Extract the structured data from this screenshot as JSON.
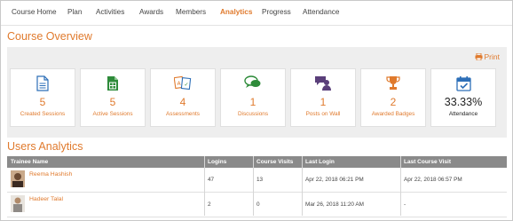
{
  "tabs": [
    {
      "label": "Course Home",
      "active": false
    },
    {
      "label": "Plan",
      "active": false
    },
    {
      "label": "Activities",
      "active": false
    },
    {
      "label": "Awards",
      "active": false
    },
    {
      "label": "Members",
      "active": false
    },
    {
      "label": "Analytics",
      "active": true
    },
    {
      "label": "Progress",
      "active": false
    },
    {
      "label": "Attendance",
      "active": false
    }
  ],
  "overview": {
    "title": "Course Overview",
    "print_label": "Print",
    "cards": [
      {
        "icon": "document-icon",
        "value": "5",
        "label": "Created Sessions"
      },
      {
        "icon": "spreadsheet-icon",
        "value": "5",
        "label": "Active Sessions"
      },
      {
        "icon": "assessment-icon",
        "value": "4",
        "label": "Assessments"
      },
      {
        "icon": "chat-bubbles-icon",
        "value": "1",
        "label": "Discussions"
      },
      {
        "icon": "users-chat-icon",
        "value": "1",
        "label": "Posts on Wall"
      },
      {
        "icon": "trophy-icon",
        "value": "2",
        "label": "Awarded Badges"
      },
      {
        "icon": "calendar-check-icon",
        "value": "33.33%",
        "label": "Attendance"
      }
    ]
  },
  "users_analytics": {
    "title": "Users Analytics",
    "columns": [
      "Trainee Name",
      "Logins",
      "Course Visits",
      "Last Login",
      "Last Course Visit"
    ],
    "rows": [
      {
        "name": "Reema Hashish",
        "logins": "47",
        "visits": "13",
        "last_login": "Apr 22, 2018 06:21 PM",
        "last_visit": "Apr 22, 2018 06:57 PM"
      },
      {
        "name": "Hadeer Talal",
        "logins": "2",
        "visits": "0",
        "last_login": "Mar 26, 2018 11:20 AM",
        "last_visit": "-"
      }
    ]
  },
  "colors": {
    "accent": "#e07a2d",
    "header_grey": "#8a8a8a",
    "panel_grey": "#eeeeee",
    "icon_blue": "#2d6fb8",
    "icon_green": "#2e8b3a",
    "icon_purple": "#5a3f7a"
  }
}
